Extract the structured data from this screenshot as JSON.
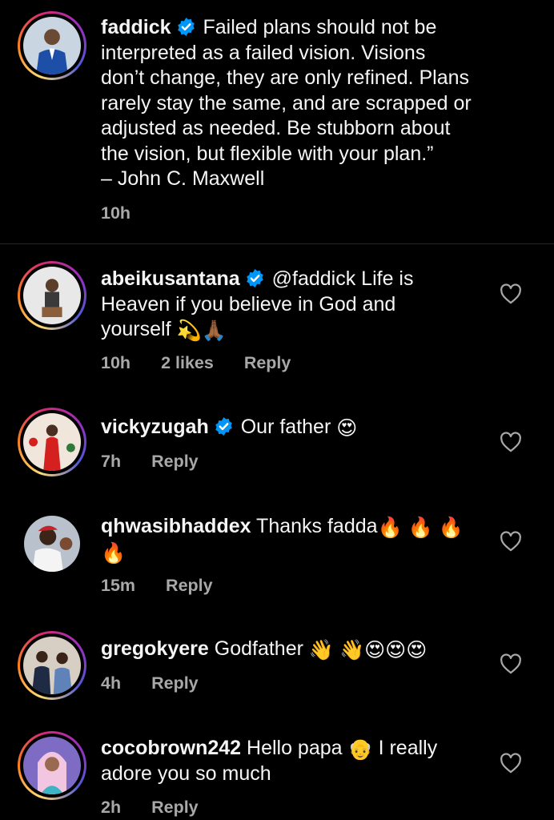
{
  "caption": {
    "username": "faddick",
    "text_lines": [
      "Failed plans should not be",
      "interpreted as a failed vision. Visions",
      "don’t change, they are only refined. Plans",
      "rarely stay the same, and are scrapped or",
      "adjusted as needed. Be stubborn about",
      "the vision, but flexible with your plan.”",
      "– John C. Maxwell"
    ],
    "time": "10h"
  },
  "comments": [
    {
      "username": "abeikusantana",
      "verified": true,
      "text_line1": "@faddick Life is",
      "text_line2": "Heaven if you believe in God and",
      "text_line3": "yourself",
      "emoji": "💫🙏🏾",
      "time": "10h",
      "likes": "2 likes",
      "reply": "Reply"
    },
    {
      "username": "vickyzugah",
      "verified": true,
      "text_line1": "Our father",
      "emoji": "😍",
      "time": "7h",
      "reply": "Reply"
    },
    {
      "username": "qhwasibhaddex",
      "verified": false,
      "text_line1": "Thanks fadda",
      "emoji": "🔥 🔥 🔥",
      "emoji2": "🔥",
      "time": "15m",
      "reply": "Reply"
    },
    {
      "username": "gregokyere",
      "verified": false,
      "text_line1": "Godfather",
      "emoji": "👋 👋😍😍😍",
      "time": "4h",
      "reply": "Reply"
    },
    {
      "username": "cocobrown242",
      "verified": false,
      "text_line1": "Hello papa",
      "emoji": "👴",
      "text_line1b": "I really",
      "text_line2": "adore you so much",
      "time": "2h",
      "reply": "Reply"
    }
  ],
  "colors": {
    "background": "#000000",
    "text": "#f5f5f5",
    "muted": "#a8a8a8",
    "verified": "#0095f6",
    "divider": "#262626"
  },
  "icons": {
    "verified": "verified-badge-icon",
    "like": "heart-outline-icon"
  }
}
